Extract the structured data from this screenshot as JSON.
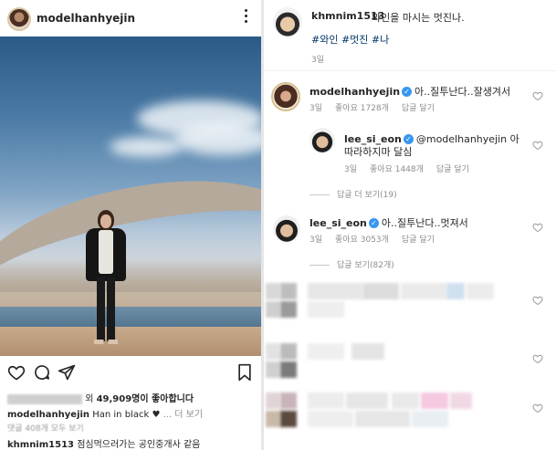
{
  "left_post": {
    "username": "modelhanhyejin",
    "likes_text_prefix": "외",
    "likes_count": "49,909",
    "likes_text_suffix": "명이 좋아합니다",
    "caption_user": "modelhanhyejin",
    "caption_text": "Han in black",
    "caption_more": "... 더 보기",
    "comments_link": "댓글 408개 모두 보기",
    "last_comment_user": "khmnim1513",
    "last_comment_text": "점심먹으러가는 공인중개사 같음"
  },
  "right_post": {
    "author": "khmnim1513",
    "text": "와인을 마시는 멋진나.",
    "hashtags": "#와인 #멋진 #나",
    "time": "3일",
    "comments": [
      {
        "user": "modelhanhyejin",
        "verified": true,
        "text": "아..질투난다..잘생겨서",
        "time": "3일",
        "likes": "좋아요 1728개",
        "reply_label": "답글 달기"
      },
      {
        "user": "lee_si_eon",
        "verified": true,
        "text": "@modelhanhyejin 아",
        "text_line2": "따라하지마 달심",
        "time": "3일",
        "likes": "좋아요 1448개",
        "reply_label": "답글 달기"
      },
      {
        "user": "lee_si_eon",
        "verified": true,
        "text": "아..질투난다..멋져서",
        "time": "3일",
        "likes": "좋아요 3053개",
        "reply_label": "답글 달기"
      }
    ],
    "more_replies_1": "답글 더 보기(19)",
    "more_replies_2": "답글 보기(82개)"
  },
  "icons": [
    "more-icon",
    "heart-icon",
    "comment-icon",
    "share-icon",
    "bookmark-icon",
    "verified-icon",
    "heart-outline-icon"
  ],
  "colors": {
    "link_blue": "#003569",
    "verified_blue": "#3897f0",
    "meta_grey": "#8e8e8e"
  }
}
